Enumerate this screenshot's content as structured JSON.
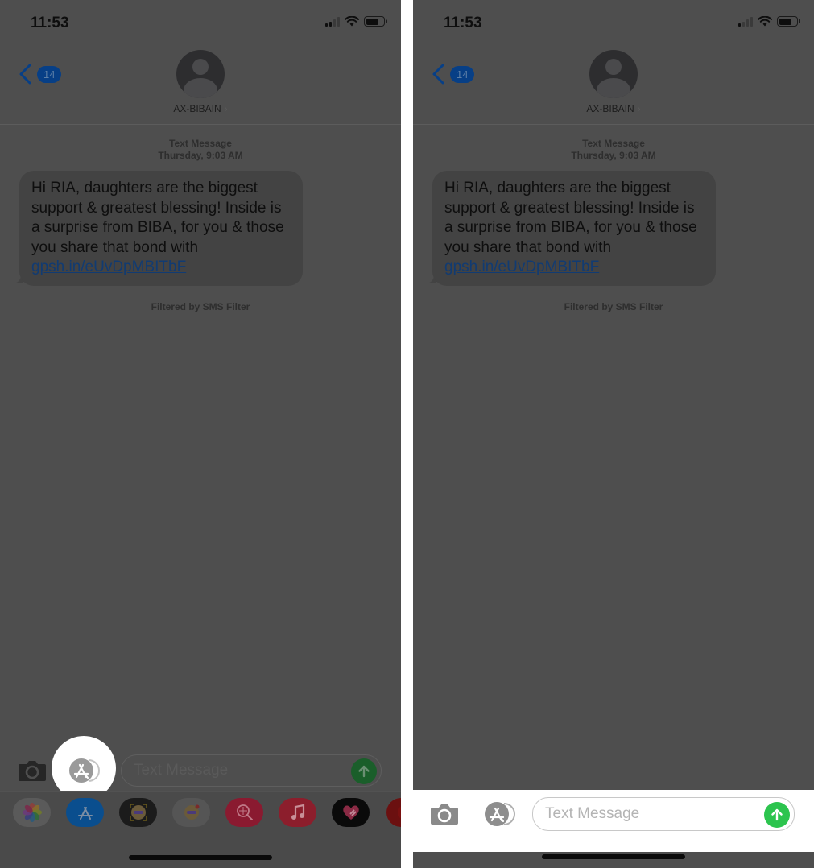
{
  "screens": [
    {
      "id": "left",
      "status_bar": {
        "time": "11:53",
        "icons": [
          "cellular-signal-icon",
          "wifi-icon",
          "battery-icon"
        ]
      },
      "nav": {
        "back_badge": "14",
        "contact_name": "AX-BIBAIN",
        "contact_chevron": "›"
      },
      "conversation": {
        "meta_label": "Text Message",
        "meta_time": "Thursday, 9:03 AM",
        "message_text": "Hi RIA, daughters are the biggest support & greatest blessing! Inside is a surprise from BIBA, for you & those you share that bond with",
        "message_link": "gpsh.in/eUvDpMBITbF",
        "filtered_note": "Filtered by SMS Filter"
      },
      "input": {
        "placeholder": "Text Message",
        "highlighted_button": "app-store-button"
      },
      "app_drawer": {
        "apps": [
          {
            "name": "Photos",
            "icon": "photos-icon",
            "color": "#5a5a5a"
          },
          {
            "name": "App Store",
            "icon": "app-store-icon",
            "color": "#0a4e8e"
          },
          {
            "name": "Memoji Stickers",
            "icon": "memoji-icon",
            "color": "#1b1b1b"
          },
          {
            "name": "Animoji",
            "icon": "animoji-icon",
            "color": "#555555"
          },
          {
            "name": "Search Images",
            "icon": "image-search-icon",
            "color": "#8a1a30"
          },
          {
            "name": "Music",
            "icon": "music-icon",
            "color": "#8c1e2c"
          },
          {
            "name": "Digital Touch",
            "icon": "digital-touch-icon",
            "color": "#0a0a0a"
          },
          {
            "name": "YouTube",
            "icon": "youtube-icon",
            "color": "#6b1010"
          }
        ]
      }
    },
    {
      "id": "right",
      "status_bar": {
        "time": "11:53",
        "icons": [
          "cellular-signal-icon",
          "wifi-icon",
          "battery-icon"
        ]
      },
      "nav": {
        "back_badge": "14",
        "contact_name": "AX-BIBAIN",
        "contact_chevron": "›"
      },
      "conversation": {
        "meta_label": "Text Message",
        "meta_time": "Thursday, 9:03 AM",
        "message_text": "Hi RIA, daughters are the biggest support & greatest blessing! Inside is a surprise from BIBA, for you & those you share that bond with",
        "message_link": "gpsh.in/eUvDpMBITbF",
        "filtered_note": "Filtered by SMS Filter"
      },
      "input": {
        "placeholder": "Text Message",
        "highlighted_area": "input-bar"
      }
    }
  ],
  "colors": {
    "dim_overlay_bg": "#4e4e4e",
    "send_green": "#2cc44e",
    "link_blue": "#113b72",
    "badge_blue": "#073f86"
  }
}
